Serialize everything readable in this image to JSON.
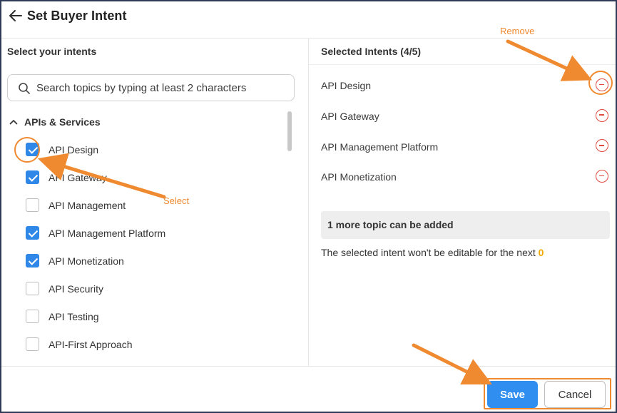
{
  "header": {
    "title": "Set Buyer Intent"
  },
  "left": {
    "heading": "Select your intents",
    "search_placeholder": "Search topics by typing at least 2 characters",
    "group": {
      "label": "APIs & Services",
      "items": [
        {
          "label": "API Design",
          "checked": true
        },
        {
          "label": "API Gateway",
          "checked": true
        },
        {
          "label": "API Management",
          "checked": false
        },
        {
          "label": "API Management Platform",
          "checked": true
        },
        {
          "label": "API Monetization",
          "checked": true
        },
        {
          "label": "API Security",
          "checked": false
        },
        {
          "label": "API Testing",
          "checked": false
        },
        {
          "label": "API-First Approach",
          "checked": false
        }
      ]
    }
  },
  "right": {
    "heading": "Selected Intents (4/5)",
    "selected": [
      {
        "label": "API Design"
      },
      {
        "label": "API Gateway"
      },
      {
        "label": "API Management Platform"
      },
      {
        "label": "API Monetization"
      }
    ],
    "info": "1 more topic can be added",
    "note_text": "The selected intent won't be editable for the next",
    "note_value": "0"
  },
  "footer": {
    "save_label": "Save",
    "cancel_label": "Cancel"
  },
  "annotations": {
    "remove_label": "Remove",
    "select_label": "Select",
    "color": "#f08a30"
  },
  "colors": {
    "checkbox_checked": "#2f87e8",
    "save_button": "#2f8ef0",
    "remove_icon": "#e04a3f",
    "highlight_value": "#f0a800"
  }
}
